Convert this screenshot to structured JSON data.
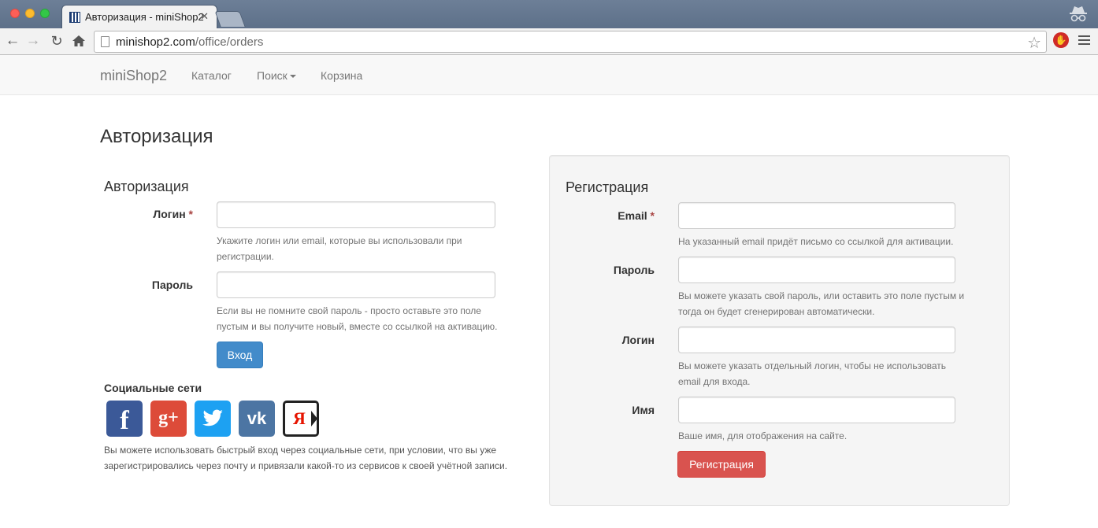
{
  "browser": {
    "tab_title": "Авторизация - miniShop2",
    "tab_close": "✕",
    "url_domain": "minishop2.com",
    "url_path": "/office/orders"
  },
  "navbar": {
    "brand": "miniShop2",
    "items": [
      {
        "label": "Каталог"
      },
      {
        "label": "Поиск"
      },
      {
        "label": "Корзина"
      }
    ]
  },
  "page": {
    "title": "Авторизация"
  },
  "login": {
    "title": "Авторизация",
    "login_label": "Логин",
    "required_mark": "*",
    "login_help": "Укажите логин или email, которые вы использовали при регистрации.",
    "password_label": "Пароль",
    "password_help": "Если вы не помните свой пароль - просто оставьте это поле пустым и вы получите новый, вместе со ссылкой на активацию.",
    "submit_label": "Вход"
  },
  "social": {
    "title": "Социальные сети",
    "items": [
      {
        "name": "facebook",
        "glyph": "f"
      },
      {
        "name": "google-plus",
        "glyph": "g+"
      },
      {
        "name": "twitter"
      },
      {
        "name": "vkontakte",
        "glyph": "vk"
      },
      {
        "name": "yandex",
        "glyph": "Я"
      }
    ],
    "help": "Вы можете использовать быстрый вход через социальные сети, при условии, что вы уже зарегистрировались через почту и привязали какой-то из сервисов к своей учётной записи."
  },
  "register": {
    "title": "Регистрация",
    "email_label": "Email",
    "required_mark": "*",
    "email_help": "На указанный email придёт письмо со ссылкой для активации.",
    "password_label": "Пароль",
    "password_help": "Вы можете указать свой пароль, или оставить это поле пустым и тогда он будет сгенерирован автоматически.",
    "username_label": "Логин",
    "username_help": "Вы можете указать отдельный логин, чтобы не использовать email для входа.",
    "name_label": "Имя",
    "name_help": "Ваше имя, для отображения на сайте.",
    "submit_label": "Регистрация"
  },
  "colors": {
    "primary": "#428bca",
    "danger": "#d9534f",
    "required": "#a94442"
  }
}
